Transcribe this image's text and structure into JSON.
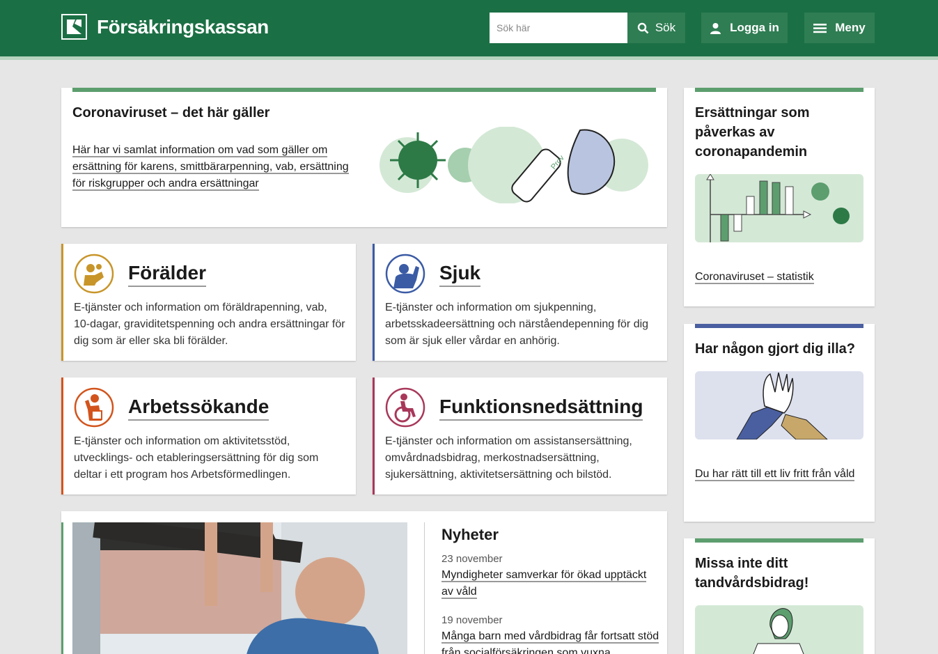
{
  "header": {
    "logo_text": "Försäkringskassan",
    "search_placeholder": "Sök här",
    "search_label": "Sök",
    "login_label": "Logga in",
    "menu_label": "Meny"
  },
  "corona": {
    "title": "Coronaviruset – det här gäller",
    "link": "Här har vi samlat information om vad som gäller om ersättning för karens, smittbärarpenning, vab, ersättning för riskgrupper och andra ersättningar",
    "tube_label": "Prov"
  },
  "categories": [
    {
      "title": "Förälder",
      "desc": "E-tjänster och information om föräldrapenning, vab, 10-dagar, graviditetspenning och andra ersättningar för dig som är eller ska bli förälder.",
      "color": "#c8952a"
    },
    {
      "title": "Sjuk",
      "desc": "E-tjänster och information om sjukpenning, arbetsskadeersättning och närståendepenning för dig som är sjuk eller vårdar en anhörig.",
      "color": "#3b5ba5"
    },
    {
      "title": "Arbetssökande",
      "desc": "E-tjänster och information om aktivitetsstöd, utvecklings- och etableringsersättning för dig som deltar i ett program hos Arbetsförmedlingen.",
      "color": "#d2541c"
    },
    {
      "title": "Funktionsnedsättning",
      "desc": "E-tjänster och information om assistansersättning, omvårdnadsbidrag, merkostnadsersättning, sjukersättning, aktivitetsersättning och bilstöd.",
      "color": "#a8385a"
    }
  ],
  "news": {
    "heading": "Nyheter",
    "items": [
      {
        "date": "23 november",
        "title": "Myndigheter samverkar för ökad upptäckt av våld"
      },
      {
        "date": "19 november",
        "title": "Många barn med vårdbidrag får fortsatt stöd från socialförsäkringen som vuxna"
      }
    ]
  },
  "side": [
    {
      "title": "Ersättningar som påverkas av coronapandemin",
      "link": "Coronaviruset – statistik"
    },
    {
      "title": "Har någon gjort dig illa?",
      "link": "Du har rätt till ett liv fritt från våld"
    },
    {
      "title": "Missa inte ditt tandvårdsbidrag!"
    }
  ],
  "colors": {
    "brand": "#1b6f44",
    "green_accent": "#5c9e6e",
    "blue_accent": "#4a5fa0"
  }
}
